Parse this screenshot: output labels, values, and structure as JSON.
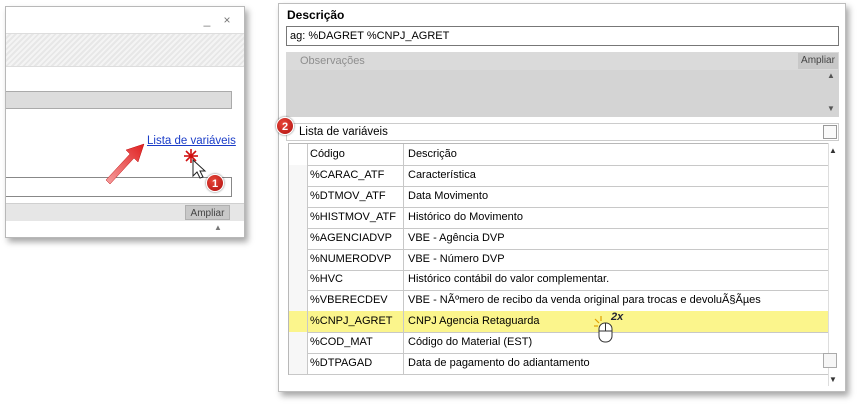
{
  "left_panel": {
    "minimize_glyph": "_",
    "close_glyph": "×",
    "variables_link": "Lista de variáveis",
    "badge": "1",
    "ampliar": "Ampliar",
    "scroll_up_glyph": "▲"
  },
  "right_panel": {
    "description_label": "Descrição",
    "description_value": "ag: %DAGRET %CNPJ_AGRET",
    "observations_label": "Observações",
    "observations_ampliar": "Ampliar",
    "scroll_up_glyph": "▲",
    "scroll_down_glyph": "▼",
    "variables_label": "Lista de variáveis",
    "badge": "2",
    "double_click_label": "2x",
    "grid": {
      "columns": [
        "Código",
        "Descrição"
      ],
      "rows": [
        {
          "code": "%CARAC_ATF",
          "desc": "Característica"
        },
        {
          "code": "%DTMOV_ATF",
          "desc": "Data Movimento"
        },
        {
          "code": "%HISTMOV_ATF",
          "desc": "Histórico do Movimento"
        },
        {
          "code": "%AGENCIADVP",
          "desc": "VBE - Agência DVP"
        },
        {
          "code": "%NUMERODVP",
          "desc": "VBE - Número DVP"
        },
        {
          "code": "%HVC",
          "desc": "Histórico contábil do valor complementar."
        },
        {
          "code": "%VBERECDEV",
          "desc": "VBE - NÃºmero de recibo da venda original para trocas e devoluÃ§Ãµes"
        },
        {
          "code": "%CNPJ_AGRET",
          "desc": "CNPJ Agencia Retaguarda"
        },
        {
          "code": "%COD_MAT",
          "desc": "Código do Material (EST)"
        },
        {
          "code": "%DTPAGAD",
          "desc": "Data de pagamento do adiantamento"
        }
      ],
      "highlighted_row_index": 7,
      "highlight_color": "#fbf58c"
    }
  },
  "colors": {
    "badge_red": "#c4161c",
    "arrow_red": "#e02020",
    "link_blue": "#1a3cc8"
  }
}
